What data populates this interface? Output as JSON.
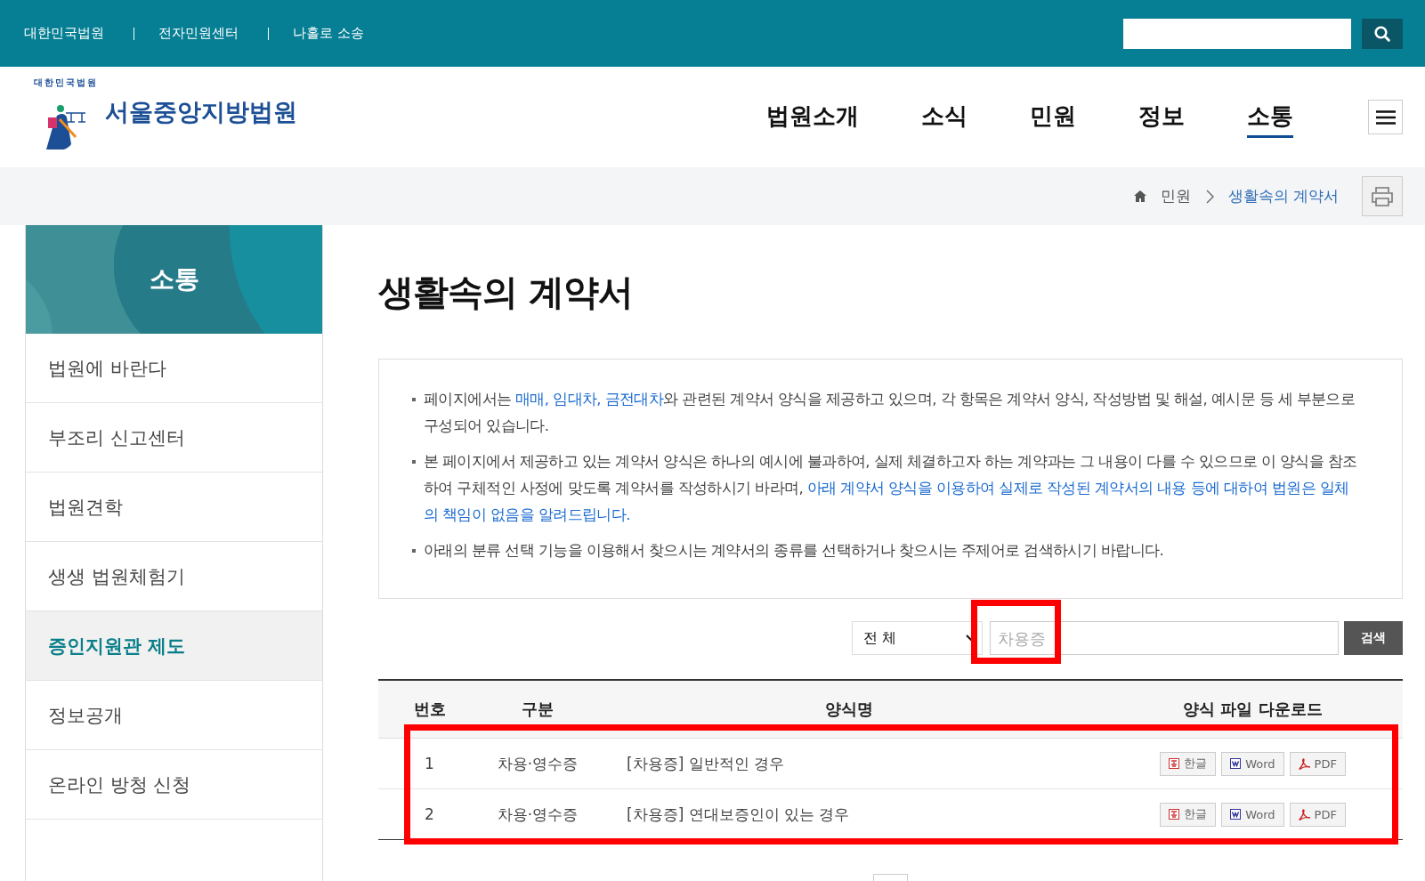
{
  "top_links": [
    "대한민국법원",
    "전자민원센터",
    "나홀로 소송"
  ],
  "logo": {
    "name": "서울중앙지방법원",
    "seal_text": "대한민국법원"
  },
  "nav": [
    {
      "label": "법원소개",
      "selected": false
    },
    {
      "label": "소식",
      "selected": false
    },
    {
      "label": "민원",
      "selected": false
    },
    {
      "label": "정보",
      "selected": false
    },
    {
      "label": "소통",
      "selected": true
    }
  ],
  "breadcrumb": [
    {
      "label": "민원",
      "current": false
    },
    {
      "label": "생활속의 계약서",
      "current": true
    }
  ],
  "sidebar": {
    "title": "소통",
    "items": [
      {
        "label": "법원에 바란다",
        "selected": false
      },
      {
        "label": "부조리 신고센터",
        "selected": false
      },
      {
        "label": "법원견학",
        "selected": false
      },
      {
        "label": "생생 법원체험기",
        "selected": false
      },
      {
        "label": "증인지원관 제도",
        "selected": true
      },
      {
        "label": "정보공개",
        "selected": false
      },
      {
        "label": "온라인 방청 신청",
        "selected": false
      }
    ]
  },
  "page_title": "생활속의 계약서",
  "notices": [
    [
      {
        "text": "페이지에서는 ",
        "emphasis": false
      },
      {
        "text": "매매, 임대차, 금전대차",
        "emphasis": true
      },
      {
        "text": "와 관련된 계약서 양식을 제공하고 있으며, 각 항목은 계약서 양식, 작성방법 및 해설, 예시문 등 세 부분으로 구성되어 있습니다.",
        "emphasis": false
      }
    ],
    [
      {
        "text": "본 페이지에서 제공하고 있는 계약서 양식은 하나의 예시에 불과하여, 실제 체결하고자 하는 계약과는 그 내용이 다를 수 있으므로 이 양식을 참조하여 구체적인 사정에 맞도록 계약서를 작성하시기 바라며, ",
        "emphasis": false
      },
      {
        "text": "아래 계약서 양식을 이용하여 실제로 작성된 계약서의 내용 등에 대하여 법원은 일체의 책임이 없음을 알려드립니다.",
        "emphasis": true
      }
    ],
    [
      {
        "text": "아래의 분류 선택 기능을 이용해서 찾으시는 계약서의 종류를 선택하거나 찾으시는 주제어로 검색하시기 바랍니다.",
        "emphasis": false
      }
    ]
  ],
  "search": {
    "category": "전 체",
    "placeholder": "차용증",
    "button": "검색"
  },
  "table": {
    "columns": [
      "번호",
      "구분",
      "양식명",
      "양식 파일 다운로드"
    ],
    "rows": [
      {
        "number": "1",
        "category": "차용·영수증",
        "title": "[차용증] 일반적인 경우",
        "downloads": [
          {
            "kind": "hwp",
            "label": "한글"
          },
          {
            "kind": "word",
            "label": "Word"
          },
          {
            "kind": "pdf",
            "label": "PDF"
          }
        ]
      },
      {
        "number": "2",
        "category": "차용·영수증",
        "title": "[차용증] 연대보증인이 있는 경우",
        "downloads": [
          {
            "kind": "hwp",
            "label": "한글"
          },
          {
            "kind": "word",
            "label": "Word"
          },
          {
            "kind": "pdf",
            "label": "PDF"
          }
        ]
      }
    ]
  }
}
